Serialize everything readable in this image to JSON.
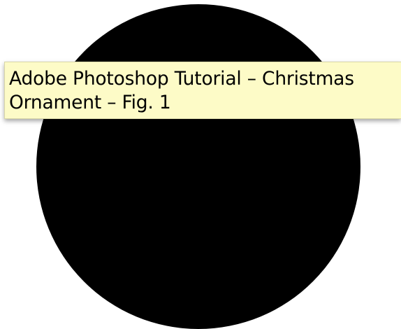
{
  "tooltip": {
    "line1": "Adobe Photoshop Tutorial – Christmas",
    "line2": "Ornament – Fig. 1"
  },
  "colors": {
    "canvas_background": "#ffffff",
    "ornament_fill": "#000000",
    "tooltip_background": "#fdfbc7"
  }
}
